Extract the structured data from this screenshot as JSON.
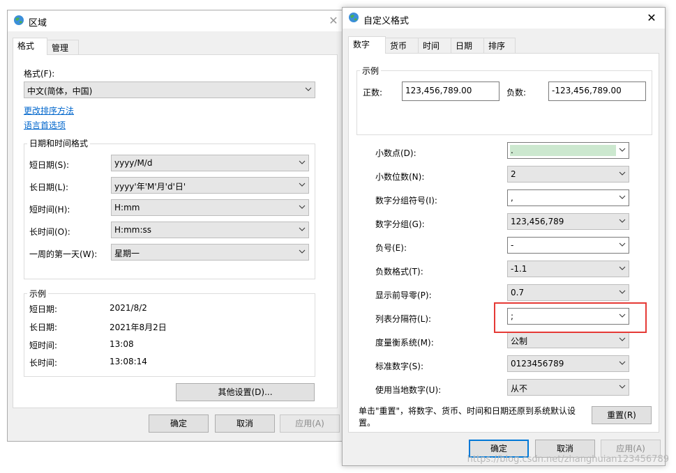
{
  "region_window": {
    "title": "区域",
    "tabs": [
      "格式",
      "管理"
    ],
    "format_label": "格式(F):",
    "format_value": "中文(简体，中国)",
    "link_sort": "更改排序方法",
    "link_lang": "语言首选项",
    "datetime_group": "日期和时间格式",
    "rows": [
      {
        "label": "短日期(S):",
        "value": "yyyy/M/d"
      },
      {
        "label": "长日期(L):",
        "value": "yyyy'年'M'月'd'日'"
      },
      {
        "label": "短时间(H):",
        "value": "H:mm"
      },
      {
        "label": "长时间(O):",
        "value": "H:mm:ss"
      },
      {
        "label": "一周的第一天(W):",
        "value": "星期一"
      }
    ],
    "example_group": "示例",
    "examples": [
      {
        "label": "短日期:",
        "value": "2021/8/2"
      },
      {
        "label": "长日期:",
        "value": "2021年8月2日"
      },
      {
        "label": "短时间:",
        "value": "13:08"
      },
      {
        "label": "长时间:",
        "value": "13:08:14"
      }
    ],
    "other_settings": "其他设置(D)...",
    "ok": "确定",
    "cancel": "取消",
    "apply": "应用(A)"
  },
  "custom_window": {
    "title": "自定义格式",
    "tabs": [
      "数字",
      "货币",
      "时间",
      "日期",
      "排序"
    ],
    "example_group": "示例",
    "positive_label": "正数:",
    "positive_value": "123,456,789.00",
    "negative_label": "负数:",
    "negative_value": "-123,456,789.00",
    "rows": [
      {
        "label": "小数点(D):",
        "value": "."
      },
      {
        "label": "小数位数(N):",
        "value": "2"
      },
      {
        "label": "数字分组符号(I):",
        "value": ","
      },
      {
        "label": "数字分组(G):",
        "value": "123,456,789"
      },
      {
        "label": "负号(E):",
        "value": "-"
      },
      {
        "label": "负数格式(T):",
        "value": "-1.1"
      },
      {
        "label": "显示前导零(P):",
        "value": "0.7"
      },
      {
        "label": "列表分隔符(L):",
        "value": ";"
      },
      {
        "label": "度量衡系统(M):",
        "value": "公制"
      },
      {
        "label": "标准数字(S):",
        "value": "0123456789"
      },
      {
        "label": "使用当地数字(U):",
        "value": "从不"
      }
    ],
    "reset_note": "单击\"重置\"，将数字、货币、时间和日期还原到系统默认设置。",
    "reset": "重置(R)",
    "ok": "确定",
    "cancel": "取消",
    "apply": "应用(A)"
  },
  "watermark": "https://blog.csdn.net/zhanghuian123456789",
  "colors": {
    "link": "#0066cc",
    "highlight": "#e53935",
    "selection": "#cce8cf"
  }
}
